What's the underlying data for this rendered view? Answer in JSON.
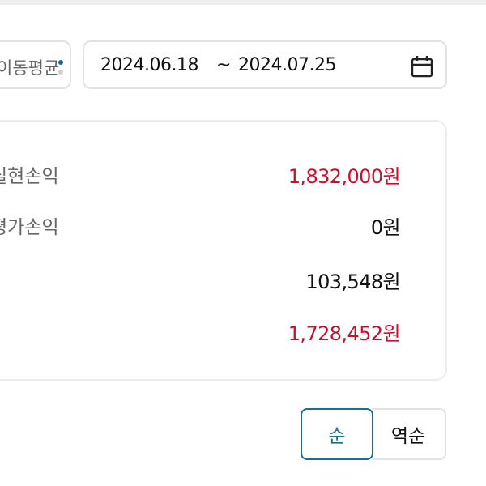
{
  "filter": {
    "select_label": "이동평균",
    "date_start": "2024.06.18",
    "date_separator": "~",
    "date_end": "2024.07.25"
  },
  "summary": {
    "rows": [
      {
        "label": "실현손익",
        "value": "1,832,000원",
        "color": "#c8102e"
      },
      {
        "label": "평가손익",
        "value": "0원",
        "color": "#111111"
      },
      {
        "label": "",
        "value": "103,548원",
        "color": "#111111"
      },
      {
        "label": "",
        "value": "1,728,452원",
        "color": "#c8102e"
      }
    ]
  },
  "sort": {
    "asc_label": "순",
    "desc_label": "역순",
    "active": "asc",
    "active_color": "#1a6e96"
  },
  "colors": {
    "positive": "#c8102e",
    "accent": "#1a6e96"
  }
}
